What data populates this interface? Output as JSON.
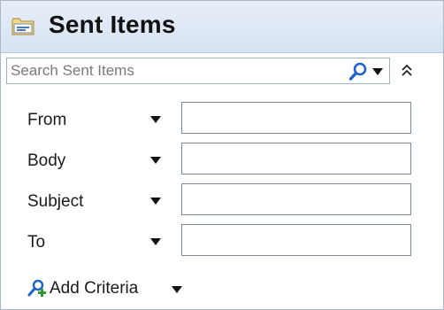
{
  "header": {
    "title": "Sent Items",
    "icon": "folder-icon"
  },
  "search": {
    "placeholder": "Search Sent Items",
    "value": "",
    "search_icon": "magnifier-icon",
    "dropdown_icon": "chevron-down-icon",
    "collapse_icon": "double-chevron-up-icon"
  },
  "criteria": [
    {
      "label": "From",
      "value": ""
    },
    {
      "label": "Body",
      "value": ""
    },
    {
      "label": "Subject",
      "value": ""
    },
    {
      "label": "To",
      "value": ""
    }
  ],
  "add_criteria": {
    "label": "Add Criteria",
    "icon": "add-person-search-icon"
  },
  "colors": {
    "header_bg": "#dde8f4",
    "accent_blue": "#1e63c8",
    "border": "#9fb1c6"
  }
}
